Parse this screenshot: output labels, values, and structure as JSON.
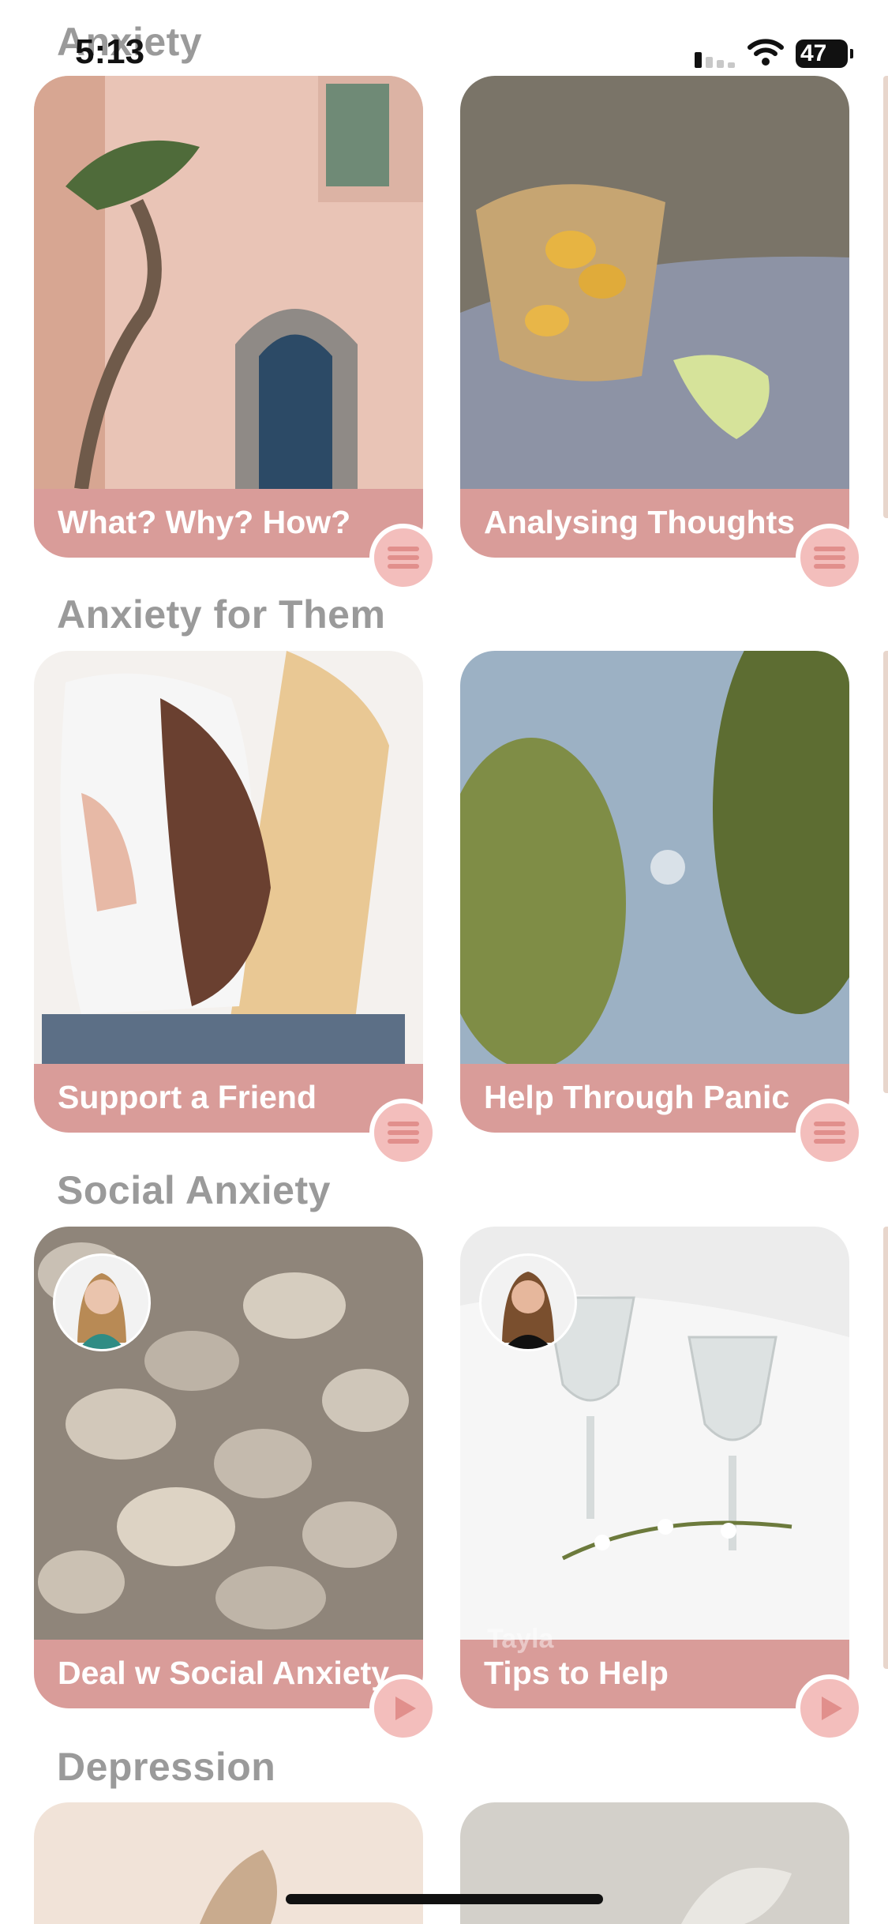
{
  "status_bar": {
    "time": "5:13",
    "battery": "47"
  },
  "sections": [
    {
      "title": "Anxiety",
      "cards": [
        {
          "label": "What? Why? How?",
          "action_icon": "menu-icon"
        },
        {
          "label": "Analysing Thoughts",
          "action_icon": "menu-icon"
        }
      ]
    },
    {
      "title": "Anxiety for Them",
      "cards": [
        {
          "label": "Support a Friend",
          "action_icon": "menu-icon"
        },
        {
          "label": "Help Through Panic",
          "action_icon": "menu-icon"
        }
      ]
    },
    {
      "title": "Social Anxiety",
      "cards": [
        {
          "label": "Deal w Social Anxiety",
          "action_icon": "play-icon"
        },
        {
          "label": "Tips to Help",
          "ghost_name": "Tayla",
          "action_icon": "play-icon"
        }
      ]
    },
    {
      "title": "Depression",
      "cards": []
    }
  ],
  "colors": {
    "card_bar": "#d99c99",
    "action_button": "#f3bebc",
    "action_icon": "#e18f8c",
    "section_title": "#9a9a9a"
  }
}
